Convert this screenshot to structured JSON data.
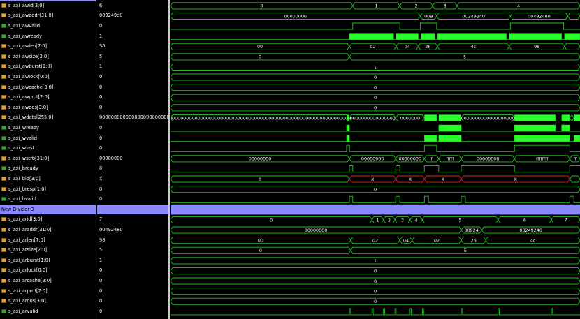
{
  "divider_label": "New Divider 3",
  "colors": {
    "wave": "#27c227",
    "fill": "#28ff28",
    "value_text": "#ffffff",
    "x_state": "#e02020",
    "divider": "#8a88ff"
  },
  "signals": [
    {
      "name": "s_axi_awid[3:0]",
      "value": "6",
      "bus": true
    },
    {
      "name": "s_axi_awaddr[31:0]",
      "value": "009249e0",
      "bus": true
    },
    {
      "name": "s_axi_awvalid",
      "value": "0",
      "bus": false
    },
    {
      "name": "s_axi_awready",
      "value": "1",
      "bus": false
    },
    {
      "name": "s_axi_awlen[7:0]",
      "value": "30",
      "bus": true
    },
    {
      "name": "s_axi_awsize[2:0]",
      "value": "5",
      "bus": true
    },
    {
      "name": "s_axi_awburst[1:0]",
      "value": "1",
      "bus": true
    },
    {
      "name": "s_axi_awlock[0:0]",
      "value": "0",
      "bus": true
    },
    {
      "name": "s_axi_awcache[3:0]",
      "value": "0",
      "bus": true
    },
    {
      "name": "s_axi_awprot[2:0]",
      "value": "0",
      "bus": true
    },
    {
      "name": "s_axi_awqos[3:0]",
      "value": "0",
      "bus": true
    },
    {
      "name": "s_axi_wdata[255:0]",
      "value": "00000000000000000000000000",
      "bus": true
    },
    {
      "name": "s_axi_wready",
      "value": "0",
      "bus": false
    },
    {
      "name": "s_axi_wvalid",
      "value": "0",
      "bus": false
    },
    {
      "name": "s_axi_wlast",
      "value": "0",
      "bus": false
    },
    {
      "name": "s_axi_wstrb[31:0]",
      "value": "00000000",
      "bus": true
    },
    {
      "name": "s_axi_bready",
      "value": "0",
      "bus": false
    },
    {
      "name": "s_axi_bid[3:0]",
      "value": "X",
      "bus": true
    },
    {
      "name": "s_axi_bresp[1:0]",
      "value": "0",
      "bus": true
    },
    {
      "name": "s_axi_bvalid",
      "value": "0",
      "bus": false
    },
    {
      "name": "New Divider 3",
      "value": "",
      "bus": false,
      "divider": true
    },
    {
      "name": "s_axi_arid[3:0]",
      "value": "7",
      "bus": true
    },
    {
      "name": "s_axi_araddr[31:0]",
      "value": "00492480",
      "bus": true
    },
    {
      "name": "s_axi_arlen[7:0]",
      "value": "98",
      "bus": true
    },
    {
      "name": "s_axi_arsize[2:0]",
      "value": "5",
      "bus": true
    },
    {
      "name": "s_axi_arburst[1:0]",
      "value": "1",
      "bus": true
    },
    {
      "name": "s_axi_arlock[0:0]",
      "value": "0",
      "bus": true
    },
    {
      "name": "s_axi_arcache[3:0]",
      "value": "0",
      "bus": true
    },
    {
      "name": "s_axi_arprot[2:0]",
      "value": "0",
      "bus": true
    },
    {
      "name": "s_axi_arqos[3:0]",
      "value": "0",
      "bus": true
    },
    {
      "name": "s_axi_arvalid",
      "value": "0",
      "bus": false
    }
  ],
  "waves": [
    {
      "kind": "bus",
      "segs": [
        {
          "a": 0,
          "b": 0.445,
          "t": "0"
        },
        {
          "a": 0.445,
          "b": 0.56,
          "t": "1"
        },
        {
          "a": 0.56,
          "b": 0.64,
          "t": "2"
        },
        {
          "a": 0.64,
          "b": 0.7,
          "t": "3"
        },
        {
          "a": 0.7,
          "b": 1,
          "t": "4"
        }
      ]
    },
    {
      "kind": "bus",
      "segs": [
        {
          "a": 0,
          "b": 0.61,
          "t": "00000000"
        },
        {
          "a": 0.61,
          "b": 0.65,
          "t": "009"
        },
        {
          "a": 0.65,
          "b": 0.83,
          "t": "00249240"
        },
        {
          "a": 0.83,
          "b": 0.97,
          "t": "00492480"
        },
        {
          "a": 0.97,
          "b": 1,
          "t": ""
        }
      ]
    },
    {
      "kind": "bit",
      "edges": [
        0.445,
        0.56,
        0.61,
        0.65,
        0.83,
        0.96
      ],
      "init": 0
    },
    {
      "kind": "fill",
      "ranges": [
        [
          0.437,
          0.545
        ],
        [
          0.551,
          0.605
        ],
        [
          0.612,
          0.645
        ],
        [
          0.652,
          0.82
        ],
        [
          0.827,
          0.955
        ],
        [
          0.962,
          1
        ]
      ],
      "init": 1
    },
    {
      "kind": "bus",
      "segs": [
        {
          "a": 0,
          "b": 0.437,
          "t": "00"
        },
        {
          "a": 0.437,
          "b": 0.551,
          "t": "02"
        },
        {
          "a": 0.551,
          "b": 0.605,
          "t": "04"
        },
        {
          "a": 0.605,
          "b": 0.652,
          "t": "26"
        },
        {
          "a": 0.652,
          "b": 0.827,
          "t": "4c"
        },
        {
          "a": 0.827,
          "b": 0.962,
          "t": "98"
        },
        {
          "a": 0.962,
          "b": 1,
          "t": ""
        }
      ]
    },
    {
      "kind": "bus",
      "segs": [
        {
          "a": 0,
          "b": 0.437,
          "t": "0"
        },
        {
          "a": 0.437,
          "b": 1,
          "t": "5"
        }
      ]
    },
    {
      "kind": "bus",
      "segs": [
        {
          "a": 0,
          "b": 1,
          "t": "1"
        }
      ]
    },
    {
      "kind": "bus",
      "segs": [
        {
          "a": 0,
          "b": 1,
          "t": "0"
        }
      ]
    },
    {
      "kind": "bus",
      "segs": [
        {
          "a": 0,
          "b": 1,
          "t": "0"
        }
      ]
    },
    {
      "kind": "bus",
      "segs": [
        {
          "a": 0,
          "b": 1,
          "t": "0"
        }
      ]
    },
    {
      "kind": "bus",
      "segs": [
        {
          "a": 0,
          "b": 1,
          "t": "0"
        }
      ]
    },
    {
      "kind": "bus",
      "fillRanges": [
        [
          0.43,
          0.437
        ],
        [
          0.62,
          0.65
        ],
        [
          0.655,
          0.71
        ],
        [
          0.84,
          0.94
        ],
        [
          0.955,
          0.975
        ],
        [
          0.985,
          1
        ]
      ],
      "segs": [
        {
          "a": 0,
          "b": 0.437,
          "t": "0000000000000000000000000000000000000000000000000000000000000000"
        },
        {
          "a": 0.437,
          "b": 0.55,
          "t": "0000000000000000"
        },
        {
          "a": 0.55,
          "b": 0.62,
          "t": "0000000"
        },
        {
          "a": 0.71,
          "b": 0.84,
          "t": "0000000000000000000"
        },
        {
          "a": 0.975,
          "b": 0.985,
          "t": ""
        }
      ]
    },
    {
      "kind": "fill",
      "ranges": [
        [
          0.43,
          0.437
        ],
        [
          0.655,
          0.71
        ],
        [
          0.84,
          0.94
        ],
        [
          0.955,
          0.975
        ]
      ],
      "init": 0
    },
    {
      "kind": "fill",
      "ranges": [
        [
          0.43,
          0.437
        ],
        [
          0.62,
          0.65
        ],
        [
          0.655,
          0.71
        ],
        [
          0.84,
          0.975
        ],
        [
          0.985,
          1
        ]
      ],
      "init": 0
    },
    {
      "kind": "bit",
      "edges": [
        0.43,
        0.437,
        0.62,
        0.65,
        0.84,
        0.975
      ],
      "init": 0
    },
    {
      "kind": "bus",
      "segs": [
        {
          "a": 0,
          "b": 0.437,
          "t": "00000000"
        },
        {
          "a": 0.437,
          "b": 0.55,
          "t": "00000000"
        },
        {
          "a": 0.55,
          "b": 0.62,
          "t": "00000000"
        },
        {
          "a": 0.62,
          "b": 0.655,
          "t": "f"
        },
        {
          "a": 0.655,
          "b": 0.71,
          "t": "fffff"
        },
        {
          "a": 0.71,
          "b": 0.84,
          "t": "00000000"
        },
        {
          "a": 0.84,
          "b": 0.975,
          "t": "ffffffff"
        },
        {
          "a": 0.975,
          "b": 1,
          "t": "ff"
        }
      ]
    },
    {
      "kind": "bit",
      "edges": [
        0.437,
        0.445,
        0.55,
        0.56,
        0.62,
        0.655,
        0.71,
        0.84,
        0.975
      ],
      "init": 0
    },
    {
      "kind": "bus",
      "x": true,
      "segs": [
        {
          "a": 0,
          "b": 0.437,
          "t": "0"
        },
        {
          "a": 0.437,
          "b": 0.55,
          "t": "X"
        },
        {
          "a": 0.55,
          "b": 0.62,
          "t": "X"
        },
        {
          "a": 0.62,
          "b": 0.71,
          "t": "X"
        },
        {
          "a": 0.71,
          "b": 0.975,
          "t": "X"
        },
        {
          "a": 0.975,
          "b": 1,
          "t": ""
        }
      ]
    },
    {
      "kind": "bus",
      "segs": [
        {
          "a": 0,
          "b": 1,
          "t": "0"
        }
      ]
    },
    {
      "kind": "bit",
      "edges": [
        0.437,
        0.445,
        0.55,
        0.56,
        0.62,
        0.63,
        0.71,
        0.72,
        0.975,
        0.985
      ],
      "init": 0
    },
    {
      "kind": "divider"
    },
    {
      "kind": "bus",
      "segs": [
        {
          "a": 0,
          "b": 0.492,
          "t": "0"
        },
        {
          "a": 0.492,
          "b": 0.52,
          "t": "1"
        },
        {
          "a": 0.52,
          "b": 0.548,
          "t": "2"
        },
        {
          "a": 0.548,
          "b": 0.585,
          "t": "3"
        },
        {
          "a": 0.585,
          "b": 0.615,
          "t": "4"
        },
        {
          "a": 0.615,
          "b": 0.8,
          "t": "5"
        },
        {
          "a": 0.8,
          "b": 0.93,
          "t": "6"
        },
        {
          "a": 0.93,
          "b": 1,
          "t": "7"
        }
      ]
    },
    {
      "kind": "bus",
      "segs": [
        {
          "a": 0,
          "b": 0.71,
          "t": "00000000"
        },
        {
          "a": 0.71,
          "b": 0.76,
          "t": "00924"
        },
        {
          "a": 0.76,
          "b": 1,
          "t": "00249240"
        }
      ]
    },
    {
      "kind": "bus",
      "segs": [
        {
          "a": 0,
          "b": 0.44,
          "t": "00"
        },
        {
          "a": 0.44,
          "b": 0.56,
          "t": "02"
        },
        {
          "a": 0.56,
          "b": 0.59,
          "t": "04"
        },
        {
          "a": 0.59,
          "b": 0.71,
          "t": "02"
        },
        {
          "a": 0.71,
          "b": 0.77,
          "t": "26"
        },
        {
          "a": 0.77,
          "b": 1,
          "t": "4c"
        }
      ]
    },
    {
      "kind": "bus",
      "segs": [
        {
          "a": 0,
          "b": 0.44,
          "t": "0"
        },
        {
          "a": 0.44,
          "b": 1,
          "t": "5"
        }
      ]
    },
    {
      "kind": "bus",
      "segs": [
        {
          "a": 0,
          "b": 1,
          "t": "1"
        }
      ]
    },
    {
      "kind": "bus",
      "segs": [
        {
          "a": 0,
          "b": 1,
          "t": "0"
        }
      ]
    },
    {
      "kind": "bus",
      "segs": [
        {
          "a": 0,
          "b": 1,
          "t": "0"
        }
      ]
    },
    {
      "kind": "bus",
      "segs": [
        {
          "a": 0,
          "b": 1,
          "t": "0"
        }
      ]
    },
    {
      "kind": "bus",
      "segs": [
        {
          "a": 0,
          "b": 1,
          "t": "0"
        }
      ]
    },
    {
      "kind": "bit",
      "edges": [
        0.437,
        0.44,
        0.492,
        0.495,
        0.52,
        0.523,
        0.548,
        0.551,
        0.585,
        0.588,
        0.615,
        0.618,
        0.71,
        0.713,
        0.8,
        0.803,
        0.93,
        0.933
      ],
      "init": 0
    }
  ]
}
